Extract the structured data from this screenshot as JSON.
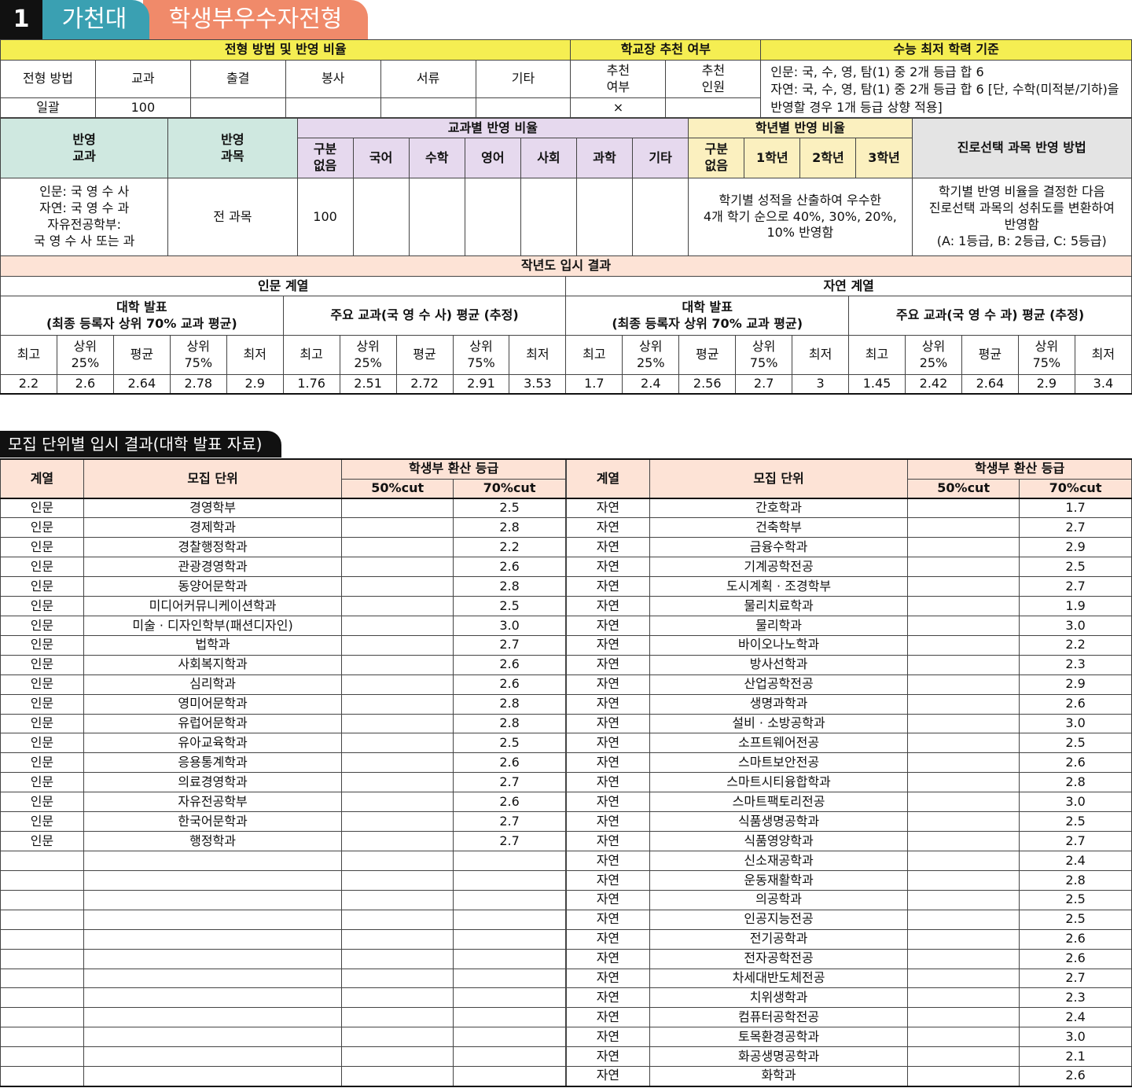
{
  "header": {
    "num": "1",
    "univ": "가천대",
    "track": "학생부우수자전형"
  },
  "t1": {
    "h_method": "전형 방법 및 반영 비율",
    "h_rec": "학교장 추천 여부",
    "h_min": "수능 최저 학력 기준",
    "cols": [
      "전형 방법",
      "교과",
      "출결",
      "봉사",
      "서류",
      "기타",
      "추천 여부",
      "추천 인원"
    ],
    "vals": [
      "일괄",
      "100",
      "",
      "",
      "",
      "",
      "×",
      ""
    ],
    "min_lines": [
      "인문: 국, 수, 영, 탐(1) 중 2개 등급 합 6",
      "자연: 국, 수, 영, 탐(1) 중 2개 등급 합 6 [단, 수학(미적분/기하)을",
      "반영할 경우 1개 등급 상향 적용]"
    ]
  },
  "t2": {
    "h_subj": "반영 교과",
    "h_course": "반영 과목",
    "h_ratio": "교과별 반영 비율",
    "h_year": "학년별 반영 비율",
    "h_career": "진로선택 과목 반영 방법",
    "ratio_cols": [
      "구분 없음",
      "국어",
      "수학",
      "영어",
      "사회",
      "과학",
      "기타"
    ],
    "year_cols": [
      "구분 없음",
      "1학년",
      "2학년",
      "3학년"
    ],
    "subj_lines": [
      "인문: 국 영 수 사",
      "자연: 국 영 수 과",
      "자유전공학부:",
      "국 영 수 사 또는 과"
    ],
    "course": "전 과목",
    "ratio_vals": [
      "100",
      "",
      "",
      "",
      "",
      "",
      ""
    ],
    "year_text": [
      "학기별 성적을 산출하여 우수한",
      "4개 학기 순으로 40%, 30%, 20%,",
      "10% 반영함"
    ],
    "career_text": [
      "학기별 반영 비율을 결정한 다음",
      "진로선택 과목의 성취도를 변환하여",
      "반영함",
      "(A: 1등급, B: 2등급, C: 5등급)"
    ]
  },
  "t3": {
    "title": "작년도 입시 결과",
    "hum": "인문 계열",
    "nat": "자연 계열",
    "pub_a": "대학 발표",
    "pub_b": "(최종 등록자 상위 70% 교과 평균)",
    "hum_est": "주요 교과(국 영 수 사) 평균 (추정)",
    "nat_est": "주요 교과(국 영 수 과) 평균 (추정)",
    "stat_cols": [
      "최고",
      "상위 25%",
      "평균",
      "상위 75%",
      "최저"
    ],
    "vals": [
      "2.2",
      "2.6",
      "2.64",
      "2.78",
      "2.9",
      "1.76",
      "2.51",
      "2.72",
      "2.91",
      "3.53",
      "1.7",
      "2.4",
      "2.56",
      "2.7",
      "3",
      "1.45",
      "2.42",
      "2.64",
      "2.9",
      "3.4"
    ]
  },
  "section2": "모집 단위별 입시 결과(대학 발표 자료)",
  "list": {
    "h_track": "계열",
    "h_unit": "모집 단위",
    "h_grade": "학생부 환산 등급",
    "h_50": "50%cut",
    "h_70": "70%cut",
    "left": [
      [
        "인문",
        "경영학부",
        "",
        "2.5"
      ],
      [
        "인문",
        "경제학과",
        "",
        "2.8"
      ],
      [
        "인문",
        "경찰행정학과",
        "",
        "2.2"
      ],
      [
        "인문",
        "관광경영학과",
        "",
        "2.6"
      ],
      [
        "인문",
        "동양어문학과",
        "",
        "2.8"
      ],
      [
        "인문",
        "미디어커뮤니케이션학과",
        "",
        "2.5"
      ],
      [
        "인문",
        "미술 · 디자인학부(패션디자인)",
        "",
        "3.0"
      ],
      [
        "인문",
        "법학과",
        "",
        "2.7"
      ],
      [
        "인문",
        "사회복지학과",
        "",
        "2.6"
      ],
      [
        "인문",
        "심리학과",
        "",
        "2.6"
      ],
      [
        "인문",
        "영미어문학과",
        "",
        "2.8"
      ],
      [
        "인문",
        "유럽어문학과",
        "",
        "2.8"
      ],
      [
        "인문",
        "유아교육학과",
        "",
        "2.5"
      ],
      [
        "인문",
        "응용통계학과",
        "",
        "2.6"
      ],
      [
        "인문",
        "의료경영학과",
        "",
        "2.7"
      ],
      [
        "인문",
        "자유전공학부",
        "",
        "2.6"
      ],
      [
        "인문",
        "한국어문학과",
        "",
        "2.7"
      ],
      [
        "인문",
        "행정학과",
        "",
        "2.7"
      ]
    ],
    "right": [
      [
        "자연",
        "간호학과",
        "",
        "1.7"
      ],
      [
        "자연",
        "건축학부",
        "",
        "2.7"
      ],
      [
        "자연",
        "금융수학과",
        "",
        "2.9"
      ],
      [
        "자연",
        "기계공학전공",
        "",
        "2.5"
      ],
      [
        "자연",
        "도시계획 · 조경학부",
        "",
        "2.7"
      ],
      [
        "자연",
        "물리치료학과",
        "",
        "1.9"
      ],
      [
        "자연",
        "물리학과",
        "",
        "3.0"
      ],
      [
        "자연",
        "바이오나노학과",
        "",
        "2.2"
      ],
      [
        "자연",
        "방사선학과",
        "",
        "2.3"
      ],
      [
        "자연",
        "산업공학전공",
        "",
        "2.9"
      ],
      [
        "자연",
        "생명과학과",
        "",
        "2.6"
      ],
      [
        "자연",
        "설비 · 소방공학과",
        "",
        "3.0"
      ],
      [
        "자연",
        "소프트웨어전공",
        "",
        "2.5"
      ],
      [
        "자연",
        "스마트보안전공",
        "",
        "2.6"
      ],
      [
        "자연",
        "스마트시티융합학과",
        "",
        "2.8"
      ],
      [
        "자연",
        "스마트팩토리전공",
        "",
        "3.0"
      ],
      [
        "자연",
        "식품생명공학과",
        "",
        "2.5"
      ],
      [
        "자연",
        "식품영양학과",
        "",
        "2.7"
      ],
      [
        "자연",
        "신소재공학과",
        "",
        "2.4"
      ],
      [
        "자연",
        "운동재활학과",
        "",
        "2.8"
      ],
      [
        "자연",
        "의공학과",
        "",
        "2.5"
      ],
      [
        "자연",
        "인공지능전공",
        "",
        "2.5"
      ],
      [
        "자연",
        "전기공학과",
        "",
        "2.6"
      ],
      [
        "자연",
        "전자공학전공",
        "",
        "2.6"
      ],
      [
        "자연",
        "차세대반도체전공",
        "",
        "2.7"
      ],
      [
        "자연",
        "치위생학과",
        "",
        "2.3"
      ],
      [
        "자연",
        "컴퓨터공학전공",
        "",
        "2.4"
      ],
      [
        "자연",
        "토목환경공학과",
        "",
        "3.0"
      ],
      [
        "자연",
        "화공생명공학과",
        "",
        "2.1"
      ],
      [
        "자연",
        "화학과",
        "",
        "2.6"
      ]
    ]
  }
}
